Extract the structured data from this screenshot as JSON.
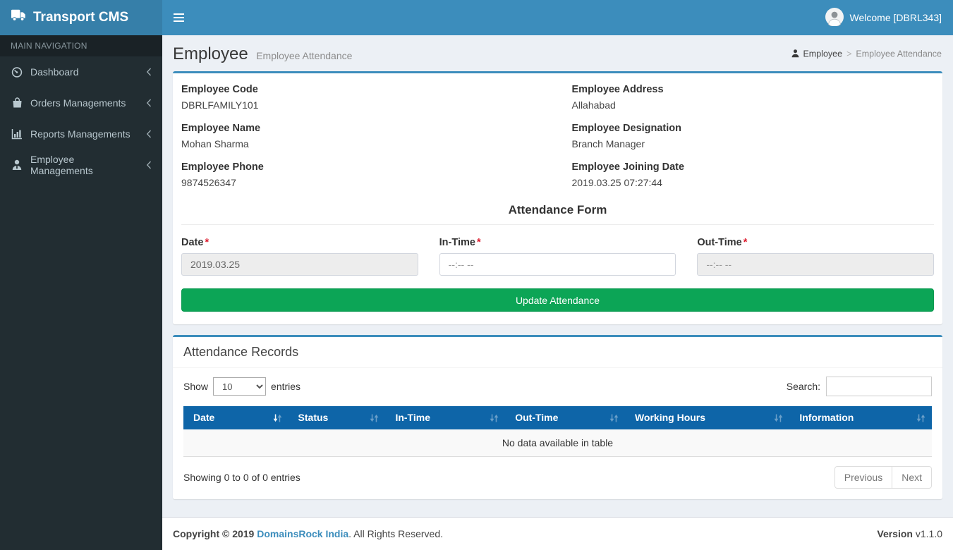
{
  "navbar": {
    "brand": "Transport CMS",
    "welcome": "Welcome [DBRL343]"
  },
  "sidebar": {
    "section_label": "MAIN NAVIGATION",
    "items": [
      {
        "label": "Dashboard",
        "icon": "dashboard-icon"
      },
      {
        "label": "Orders Managements",
        "icon": "orders-icon"
      },
      {
        "label": "Reports Managements",
        "icon": "reports-icon"
      },
      {
        "label": "Employee Managements",
        "icon": "employee-icon"
      }
    ]
  },
  "page_header": {
    "title": "Employee",
    "subtitle": "Employee Attendance",
    "breadcrumb": {
      "root": "Employee",
      "separator": ">",
      "current": "Employee Attendance"
    }
  },
  "employee_info": {
    "fields": [
      {
        "label": "Employee Code",
        "value": "DBRLFAMILY101"
      },
      {
        "label": "Employee Name",
        "value": "Mohan Sharma"
      },
      {
        "label": "Employee Phone",
        "value": "9874526347"
      },
      {
        "label": "Employee Address",
        "value": "Allahabad"
      },
      {
        "label": "Employee Designation",
        "value": "Branch Manager"
      },
      {
        "label": "Employee Joining Date",
        "value": "2019.03.25 07:27:44"
      }
    ]
  },
  "attendance_form": {
    "title": "Attendance Form",
    "required_marker": "*",
    "date": {
      "label": "Date",
      "value": "2019.03.25"
    },
    "in_time": {
      "label": "In-Time",
      "placeholder": "--:-- --"
    },
    "out_time": {
      "label": "Out-Time",
      "placeholder": "--:-- --"
    },
    "submit_label": "Update Attendance"
  },
  "records": {
    "title": "Attendance Records",
    "show_label": "Show",
    "entries_label": "entries",
    "page_length": "10",
    "search_label": "Search:",
    "search_value": "",
    "columns": [
      "Date",
      "Status",
      "In-Time",
      "Out-Time",
      "Working Hours",
      "Information"
    ],
    "empty_message": "No data available in table",
    "summary": "Showing 0 to 0 of 0 entries",
    "pagination": {
      "previous": "Previous",
      "next": "Next"
    }
  },
  "footer": {
    "copyright_prefix": "Copyright © 2019",
    "company": "DomainsRock India",
    "copyright_suffix": ". All Rights Reserved.",
    "version_label": "Version",
    "version_value": "v1.1.0"
  },
  "colors": {
    "navbar": "#3c8dbc",
    "brand_bg": "#367fa9",
    "sidebar_bg": "#222d32",
    "table_header": "#0e65a8",
    "submit_button": "#0ca556",
    "link": "#3c8dbc",
    "required": "#dc1c2e"
  }
}
